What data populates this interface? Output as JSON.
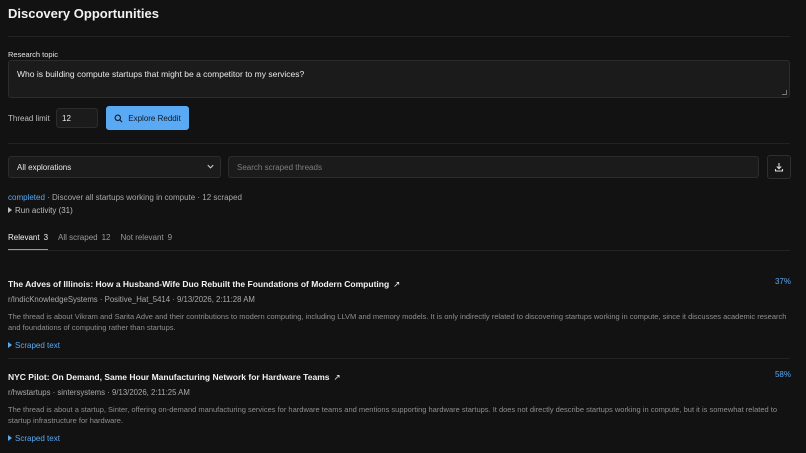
{
  "page": {
    "title": "Discovery Opportunities"
  },
  "research": {
    "label": "Research topic",
    "value": "Who is building compute startups that might be a competitor to my services?"
  },
  "controls": {
    "thread_limit_label": "Thread limit",
    "thread_limit_value": "12",
    "explore_label": "Explore Reddit"
  },
  "filters": {
    "select_value": "All explorations",
    "search_placeholder": "Search scraped threads"
  },
  "status": {
    "state": "completed",
    "detail": " · Discover all startups working in compute · 12 scraped",
    "run_activity": "Run activity (31)"
  },
  "tabs": [
    {
      "label": "Relevant",
      "count": "3"
    },
    {
      "label": "All scraped",
      "count": "12"
    },
    {
      "label": "Not relevant",
      "count": "9"
    }
  ],
  "items": [
    {
      "title": "The Adves of Illinois: How a Husband-Wife Duo Rebuilt the Foundations of Modern Computing",
      "meta": "r/IndicKnowledgeSystems · Positive_Hat_5414 · 9/13/2026, 2:11:28 AM",
      "description": "The thread is about Vikram and Sarita Adve and their contributions to modern computing, including LLVM and memory models. It is only indirectly related to discovering startups working in compute, since it discusses academic research and foundations of computing rather than startups.",
      "scraped_label": "Scraped text",
      "score": "37%"
    },
    {
      "title": "NYC Pilot: On Demand, Same Hour Manufacturing Network for Hardware Teams",
      "meta": "r/hwstartups · sintersystems · 9/13/2026, 2:11:25 AM",
      "description": "The thread is about a startup, Sinter, offering on-demand manufacturing services for hardware teams and mentions supporting hardware startups. It does not directly describe startups working in compute, but it is somewhat related to startup infrastructure for hardware.",
      "scraped_label": "Scraped text",
      "score": "58%"
    }
  ],
  "colors": {
    "accent": "#5aa9f5",
    "background": "#121212"
  },
  "icons": {
    "explore": "search-icon",
    "select": "chevron-down-icon",
    "download": "download-icon",
    "external": "external-link-icon"
  }
}
